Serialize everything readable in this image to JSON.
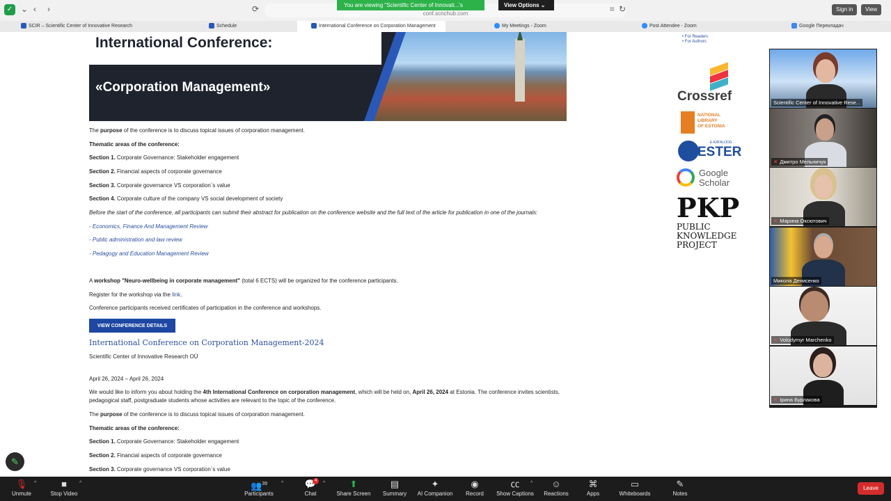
{
  "browser": {
    "share_banner": "You are viewing \"Scientific Center of Innovati...'s screen",
    "view_options": "View Options",
    "url": "conf.scnchub.com",
    "signin": "Sign in",
    "view": "View"
  },
  "tabs": [
    {
      "label": "SCIR – Scientific Center of Innovative Research"
    },
    {
      "label": "Schedule"
    },
    {
      "label": "International Conference on Corporation Management"
    },
    {
      "label": "My Meetings - Zoom"
    },
    {
      "label": "Post Attendee - Zoom"
    },
    {
      "label": "Google Перекладач"
    }
  ],
  "banner": {
    "title_line1": "International Conference:",
    "title_line2": "«Corporation Management»"
  },
  "content": {
    "purpose_pre": "The ",
    "purpose_bold": "purpose",
    "purpose_post": " of the conference is to discuss topical issues of corporation management.",
    "thematic": "Thematic areas of the conference:",
    "sections": [
      {
        "num": "Section 1.",
        "text": " Corporate Governance: Stakeholder engagement"
      },
      {
        "num": "Section 2.",
        "text": " Financial aspects of corporate governance"
      },
      {
        "num": "Section 3.",
        "text": " Corporate governance VS corporation`s value"
      },
      {
        "num": "Section 4.",
        "text": " Corporate culture of the company VS social development of society"
      }
    ],
    "before_text": "Before the start of the conference, all participants can submit their abstract for publication on the conference website and the full text of the article for publication in one of the journals:",
    "journals": [
      "- Economics, Finance And Management Review",
      "- Public administration and law review",
      "- Pedagogy and Education Management Review"
    ],
    "workshop_pre": "A ",
    "workshop_bold": "workshop \"Neuro-wellbeing in corporate management\"",
    "workshop_post": " (total 6 ECTS) will be organized for the conference participants.",
    "register_pre": "Register for the workshop via the ",
    "register_link": "link",
    "register_post": ".",
    "certificates": "Conference participants received certificates of participation in the conference and workshops.",
    "details_button": "VIEW CONFERENCE DETAILS",
    "conf_title": "International Conference on Corporation Management-2024",
    "organizer": "Scientific Center of Innovative Research OÜ",
    "dates": "April 26, 2024 – April 26, 2024",
    "inform_pre": "We would like to inform you about holding the ",
    "inform_bold": "4th International Conference on corporation management",
    "inform_mid": ", which will be held on, ",
    "inform_date": "April 26, 2024",
    "inform_post": " at Estonia. The conference invites scientists,",
    "inform_line2": "pedagogical staff, postgraduate students whose activities are relevant to the topic of the conference."
  },
  "sidebar": {
    "readers": "For Readers",
    "authors": "For Authors",
    "crossref": "Crossref",
    "nle": [
      "NATIONAL",
      "LIBRARY",
      "OF ESTONIA"
    ],
    "ester": "ESTER",
    "ester_small": "E-KATALOOG",
    "gs_line1": "Google",
    "gs_line2": "Scholar",
    "pkp_big": "PKP",
    "pkp_small": [
      "PUBLIC",
      "KNOWLEDGE",
      "PROJECT"
    ]
  },
  "participants": [
    {
      "name": "Scientific Center of Innovative Rese..."
    },
    {
      "name": "Дмитро Мельничук"
    },
    {
      "name": "Марина Оксютович"
    },
    {
      "name": "Микола Денисенко"
    },
    {
      "name": "Volodymyr Marchenko"
    },
    {
      "name": "Ірина Бурлакова"
    }
  ],
  "toolbar": {
    "unmute": "Unmute",
    "stop_video": "Stop Video",
    "participants": "Participants",
    "participants_count": "39",
    "chat": "Chat",
    "chat_badge": "4",
    "share_screen": "Share Screen",
    "summary": "Summary",
    "ai": "AI Companion",
    "record": "Record",
    "captions": "Show Captions",
    "reactions": "Reactions",
    "apps": "Apps",
    "whiteboards": "Whiteboards",
    "notes": "Notes",
    "leave": "Leave"
  }
}
